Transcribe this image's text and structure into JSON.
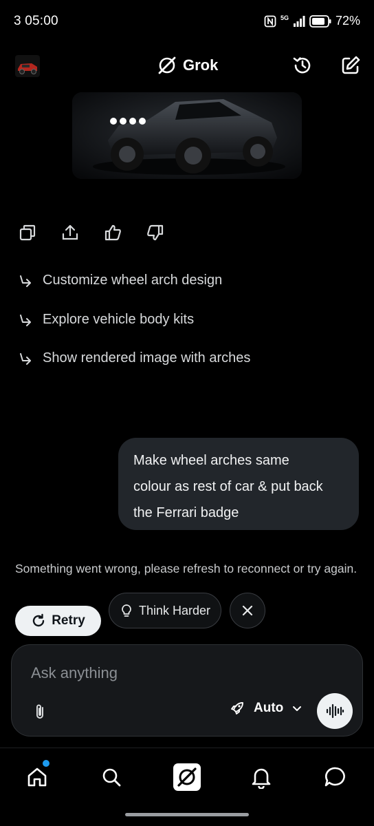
{
  "status_bar": {
    "time": "3 05:00",
    "network": "5G",
    "battery": "72%"
  },
  "header": {
    "app_name": "Grok",
    "avatar_icon": "car-avatar-icon",
    "history_icon": "history-icon",
    "new_chat_icon": "compose-icon"
  },
  "assistant": {
    "image_icon": "black-offroad-car-image",
    "actions": [
      "copy-icon",
      "share-icon",
      "thumbs-up-icon",
      "thumbs-down-icon"
    ],
    "suggestions": [
      "Customize wheel arch design",
      "Explore vehicle body kits",
      "Show rendered image with arches"
    ]
  },
  "user_message": {
    "lines": [
      "Make wheel arches same",
      "colour as rest of car & put back",
      "the Ferrari badge"
    ]
  },
  "error": {
    "message": "Something went wrong, please refresh to reconnect or try again.",
    "retry_label": "Retry",
    "think_harder_label": "Think Harder"
  },
  "composer": {
    "placeholder": "Ask anything",
    "mode_label": "Auto"
  },
  "colors": {
    "background": "#000000",
    "bubble": "#22262b",
    "accent_dot": "#1d9bf0",
    "button_light": "#eef1f3"
  },
  "bottom_nav": [
    "home-icon",
    "search-icon",
    "grok-icon",
    "notifications-icon",
    "messages-icon"
  ]
}
